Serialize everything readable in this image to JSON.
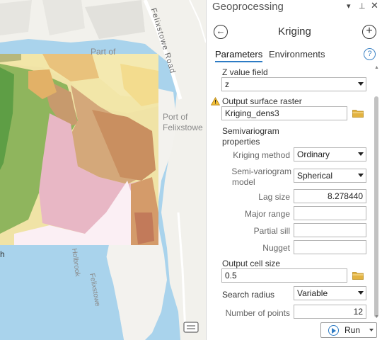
{
  "map": {
    "labels": {
      "road": "Felixstowe Road",
      "part_of": "Part of",
      "port_line1": "Port of",
      "port_line2": "Felixstowe",
      "felixstowe": "Felixstowe",
      "holbrook": "Holbrook",
      "edge_h": "h"
    },
    "icons": {
      "legend": "legend-icon"
    }
  },
  "panel": {
    "title": "Geoprocessing",
    "header_icons": [
      "menu-icon",
      "pin-icon",
      "close-icon"
    ],
    "menu_glyph": "▾",
    "pin_glyph": "⊥",
    "close_glyph": "✕",
    "tool_title": "Kriging",
    "back_glyph": "←",
    "add_glyph": "+",
    "tabs": [
      "Parameters",
      "Environments"
    ],
    "help_glyph": "?"
  },
  "params": {
    "z_value_field": {
      "label": "Z value field",
      "value": "z"
    },
    "output_surface_raster": {
      "label": "Output surface raster",
      "value": "Kriging_dens3",
      "warning_icon": "warning-icon"
    },
    "semivariogram": {
      "label_line1": "Semivariogram",
      "label_line2": "properties"
    },
    "kriging_method": {
      "label": "Kriging method",
      "value": "Ordinary"
    },
    "semivariogram_model": {
      "label_line1": "Semi-variogram",
      "label_line2": "model",
      "value": "Spherical"
    },
    "lag_size": {
      "label": "Lag size",
      "value": "8.278440"
    },
    "major_range": {
      "label": "Major range",
      "value": ""
    },
    "partial_sill": {
      "label": "Partial sill",
      "value": ""
    },
    "nugget": {
      "label": "Nugget",
      "value": ""
    },
    "output_cell_size": {
      "label": "Output cell size",
      "value": "0.5"
    },
    "search_radius": {
      "label": "Search radius",
      "value": "Variable"
    },
    "number_of_points": {
      "label": "Number of points",
      "value": "12"
    }
  },
  "run": {
    "label": "Run"
  },
  "colors": {
    "water": "#a9d3ec",
    "land": "#f2f1ec",
    "accent": "#2d7bc4",
    "warning": "#e8a317",
    "folder": "#e3b341"
  }
}
